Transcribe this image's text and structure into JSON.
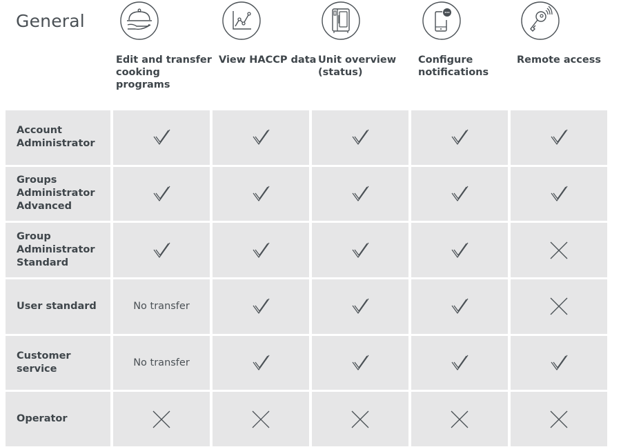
{
  "page": {
    "title": "General"
  },
  "columns": [
    {
      "label": "Edit and transfer cooking programs",
      "icon": "serving-cloche-icon"
    },
    {
      "label": "View HACCP data",
      "icon": "line-graph-icon"
    },
    {
      "label": "Unit overview (status)",
      "icon": "combi-oven-icon"
    },
    {
      "label": "Configure notifications",
      "icon": "phone-notification-icon"
    },
    {
      "label": "Remote access",
      "icon": "remote-key-icon"
    }
  ],
  "rows": [
    {
      "role": "Account Administrator",
      "cells": [
        "check",
        "check",
        "check",
        "check",
        "check"
      ]
    },
    {
      "role": "Groups Administrator Advanced",
      "cells": [
        "check",
        "check",
        "check",
        "check",
        "check"
      ]
    },
    {
      "role": "Group Administrator Standard",
      "cells": [
        "check",
        "check",
        "check",
        "check",
        "cross"
      ]
    },
    {
      "role": "User standard",
      "cells": [
        "No transfer",
        "check",
        "check",
        "check",
        "cross"
      ]
    },
    {
      "role": "Customer service",
      "cells": [
        "No transfer",
        "check",
        "check",
        "check",
        "check"
      ]
    },
    {
      "role": "Operator",
      "cells": [
        "cross",
        "cross",
        "cross",
        "cross",
        "cross"
      ]
    }
  ],
  "colors": {
    "cell_background": "#e6e6e7",
    "text": "#444a4f",
    "icon_stroke": "#4a5055"
  }
}
